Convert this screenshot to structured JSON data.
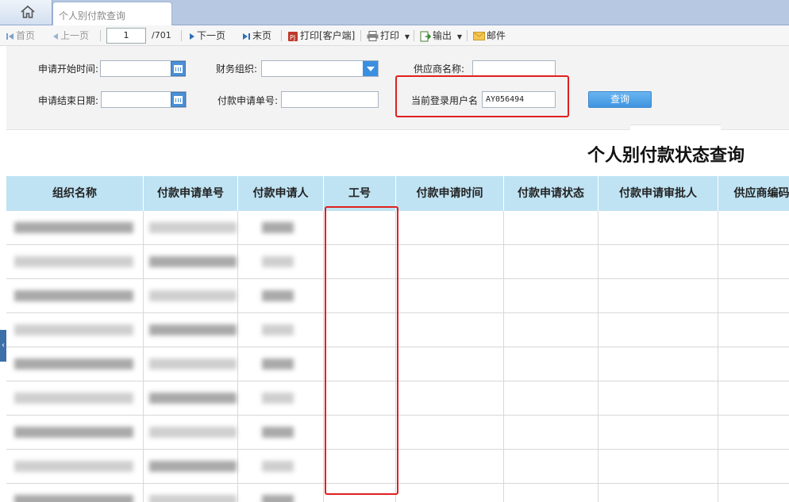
{
  "tabs": {
    "home_icon": "home-icon",
    "active_tab": "个人别付款查询"
  },
  "toolbar": {
    "first": "首页",
    "prev": "上一页",
    "page_value": "1",
    "page_total": "/701",
    "next": "下一页",
    "last": "末页",
    "print_client": "打印[客户端]",
    "print": "打印",
    "export": "输出",
    "mail": "邮件"
  },
  "form": {
    "start_time_label": "申请开始时间:",
    "end_date_label": "申请结束日期:",
    "finance_org_label": "财务组织:",
    "payment_no_label": "付款申请单号:",
    "supplier_label": "供应商名称:",
    "login_user_label": "当前登录用户名",
    "login_user_value": "AY056494",
    "query_button": "查询"
  },
  "report": {
    "title": "个人别付款状态查询",
    "columns": [
      "组织名称",
      "付款申请单号",
      "付款申请人",
      "工号",
      "付款申请时间",
      "付款申请状态",
      "付款申请审批人",
      "供应商编码"
    ]
  },
  "colors": {
    "header_bg": "#bfe3f3",
    "highlight": "#e02020",
    "query_button": "#3f95e0"
  }
}
